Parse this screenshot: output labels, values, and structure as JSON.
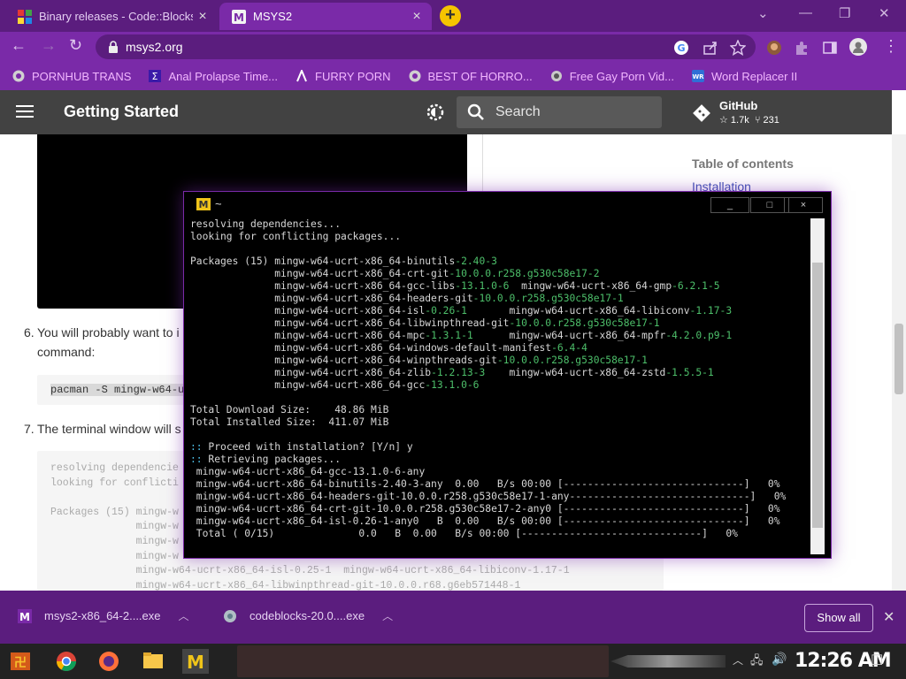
{
  "tabs": [
    {
      "title": "Binary releases - Code::Blocks",
      "active": false
    },
    {
      "title": "MSYS2",
      "active": true
    }
  ],
  "address": {
    "url": "msys2.org"
  },
  "bookmarks": [
    {
      "label": "PORNHUB TRANS"
    },
    {
      "label": "Anal Prolapse Time..."
    },
    {
      "label": "FURRY PORN"
    },
    {
      "label": "BEST OF HORRO..."
    },
    {
      "label": "Free Gay Porn Vid..."
    },
    {
      "label": "Word Replacer II"
    }
  ],
  "site": {
    "title": "Getting Started",
    "search_placeholder": "Search",
    "github": {
      "name": "GitHub",
      "stars": "1.7k",
      "forks": "231"
    }
  },
  "toc": {
    "heading": "Table of contents",
    "first_link": "Installation"
  },
  "steps": [
    {
      "num": "6.",
      "line1": "You will probably want to i",
      "line2": "command:"
    },
    {
      "num": "7.",
      "line1": "The terminal window will s"
    }
  ],
  "code_cmd": "pacman -S mingw-w64-u",
  "codebox_lines": [
    "resolving dependencie",
    "looking for conflicti",
    "",
    "Packages (15) mingw-w",
    "              mingw-w",
    "              mingw-w",
    "              mingw-w",
    "              mingw-w64-ucrt-x86_64-isl-0.25-1  mingw-w64-ucrt-x86_64-libiconv-1.17-1",
    "              mingw-w64-ucrt-x86_64-libwinpthread-git-10.0.0.r68.g6eb571448-1"
  ],
  "terminal": {
    "title": "~",
    "buttons": {
      "min": "_",
      "max": "□",
      "close": "×"
    },
    "lines": {
      "l1": "resolving dependencies...",
      "l2": "looking for conflicting packages...",
      "pk_label": "Packages (15)",
      "packages": [
        [
          "mingw-w64-ucrt-x86_64-binutils",
          "-2.40-3",
          "",
          ""
        ],
        [
          "mingw-w64-ucrt-x86_64-crt-git",
          "-10.0.0.r258.g530c58e17-2",
          "",
          ""
        ],
        [
          "mingw-w64-ucrt-x86_64-gcc-libs",
          "-13.1.0-6",
          "mingw-w64-ucrt-x86_64-gmp",
          "-6.2.1-5"
        ],
        [
          "mingw-w64-ucrt-x86_64-headers-git",
          "-10.0.0.r258.g530c58e17-1",
          "",
          ""
        ],
        [
          "mingw-w64-ucrt-x86_64-isl",
          "-0.26-1",
          "mingw-w64-ucrt-x86_64-libiconv",
          "-1.17-3"
        ],
        [
          "mingw-w64-ucrt-x86_64-libwinpthread-git",
          "-10.0.0.r258.g530c58e17-1",
          "",
          ""
        ],
        [
          "mingw-w64-ucrt-x86_64-mpc",
          "-1.3.1-1",
          "mingw-w64-ucrt-x86_64-mpfr",
          "-4.2.0.p9-1"
        ],
        [
          "mingw-w64-ucrt-x86_64-windows-default-manifest",
          "-6.4-4",
          "",
          ""
        ],
        [
          "mingw-w64-ucrt-x86_64-winpthreads-git",
          "-10.0.0.r258.g530c58e17-1",
          "",
          ""
        ],
        [
          "mingw-w64-ucrt-x86_64-zlib",
          "-1.2.13-3",
          "mingw-w64-ucrt-x86_64-zstd",
          "-1.5.5-1"
        ],
        [
          "mingw-w64-ucrt-x86_64-gcc",
          "-13.1.0-6",
          "",
          ""
        ]
      ],
      "dl_label": "Total Download Size:",
      "dl_val": "48.86 MiB",
      "inst_label": "Total Installed Size:",
      "inst_val": "411.07 MiB",
      "proceed": "Proceed with installation? [Y/n]",
      "proceed_answer": "y",
      "retrieving": "Retrieving packages...",
      "progress": [
        "mingw-w64-ucrt-x86_64-gcc-13.1.0-6-any",
        "mingw-w64-ucrt-x86_64-binutils-2.40-3-any  0.00   B/s 00:00 [------------------------------]   0%",
        "mingw-w64-ucrt-x86_64-headers-git-10.0.0.r258.g530c58e17-1-any------------------------------]   0%",
        "mingw-w64-ucrt-x86_64-crt-git-10.0.0.r258.g530c58e17-2-any0 [------------------------------]   0%",
        "mingw-w64-ucrt-x86_64-isl-0.26-1-any0   B  0.00   B/s 00:00 [------------------------------]   0%",
        "Total ( 0/15)              0.0   B  0.00   B/s 00:00 [------------------------------]   0%"
      ]
    }
  },
  "downloads": [
    {
      "name": "msys2-x86_64-2....exe"
    },
    {
      "name": "codeblocks-20.0....exe"
    }
  ],
  "show_all": "Show all",
  "clock": "12:26 AM",
  "colors": {
    "accent": "#7a2aa8",
    "tabstrip": "#5b1d7e",
    "site_header": "#424242"
  }
}
